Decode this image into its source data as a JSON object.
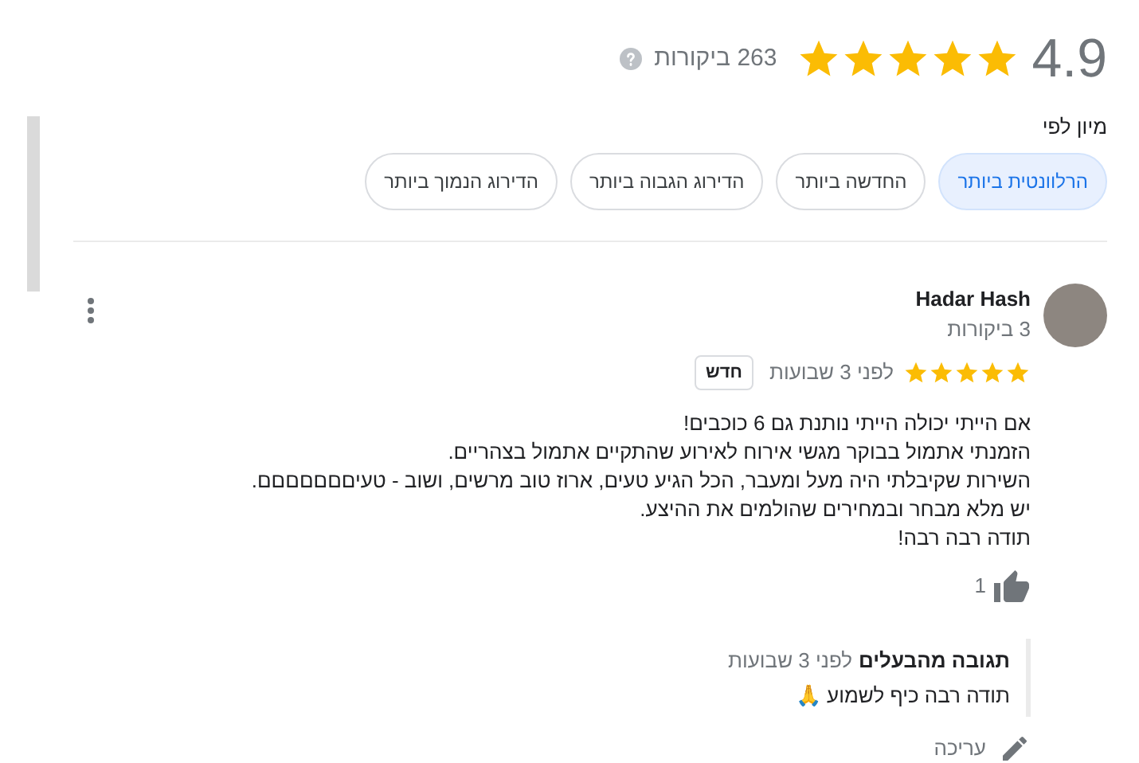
{
  "summary": {
    "rating": "4.9",
    "stars": 5,
    "count": "263 ביקורות"
  },
  "sort": {
    "label": "מיון לפי",
    "options": [
      {
        "label": "הרלוונטית ביותר",
        "selected": true
      },
      {
        "label": "החדשה ביותר",
        "selected": false
      },
      {
        "label": "הדירוג הגבוה ביותר",
        "selected": false
      },
      {
        "label": "הדירוג הנמוך ביותר",
        "selected": false
      }
    ]
  },
  "review": {
    "author": "Hadar Hash",
    "author_reviews": "3 ביקורות",
    "stars": 5,
    "time": "לפני 3 שבועות",
    "badge": "חדש",
    "lines": [
      "אם הייתי יכולה הייתי נותנת גם 6 כוכבים!",
      "הזמנתי אתמול בבוקר מגשי אירוח לאירוע שהתקיים אתמול בצהריים.",
      "השירות שקיבלתי היה מעל ומעבר, הכל הגיע טעים, ארוז טוב מרשים, ושוב - טעיםםםםםםם.",
      "יש מלא מבחר ובמחירים שהולמים את ההיצע.",
      "תודה רבה רבה!"
    ],
    "likes": "1",
    "reply": {
      "title": "תגובה מהבעלים",
      "time": "לפני 3 שבועות",
      "text": "תודה רבה כיף לשמוע 🙏"
    },
    "edit": "עריכה"
  }
}
